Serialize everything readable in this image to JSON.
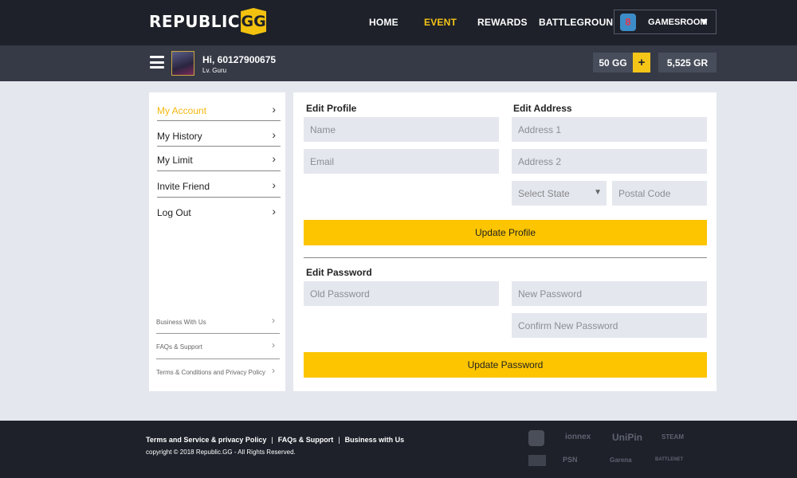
{
  "brand": {
    "logo_text": "REPUBLIC",
    "logo_mark": "GG"
  },
  "nav": {
    "items": [
      {
        "label": "HOME",
        "active": false
      },
      {
        "label": "EVENT",
        "active": true
      },
      {
        "label": "REWARDS",
        "active": false
      },
      {
        "label": "BATTLEGROUND",
        "active": false
      }
    ],
    "games_dropdown": "GAMESROOM"
  },
  "user": {
    "greeting": "Hi, 60127900675",
    "level": "Lv. Guru",
    "gg_balance": "50 GG",
    "gr_balance": "5,525 GR",
    "add_label": "+"
  },
  "sidebar": {
    "items": [
      {
        "label": "My Account",
        "active": true
      },
      {
        "label": "My History",
        "active": false
      },
      {
        "label": "My Limit",
        "active": false
      },
      {
        "label": "Invite Friend",
        "active": false
      },
      {
        "label": "Log Out",
        "active": false
      }
    ],
    "secondary": [
      {
        "label": "Business With Us"
      },
      {
        "label": "FAQs & Support"
      },
      {
        "label": "Terms & Conditions and Privacy Policy"
      }
    ]
  },
  "profile": {
    "title": "Edit Profile",
    "name_placeholder": "Name",
    "email_placeholder": "Email",
    "button": "Update Profile"
  },
  "address": {
    "title": "Edit Address",
    "address1_placeholder": "Address 1",
    "address2_placeholder": "Address 2",
    "state_placeholder": "Select State",
    "postal_placeholder": "Postal Code"
  },
  "password": {
    "title": "Edit Password",
    "old_placeholder": "Old Password",
    "new_placeholder": "New Password",
    "confirm_placeholder": "Confirm New Password",
    "button": "Update Password"
  },
  "footer": {
    "links": [
      "Terms and Service & privacy Policy",
      "FAQs & Support",
      "Business with Us"
    ],
    "copyright": "copyright © 2018 Republic.GG  -  All Rights Reserved.",
    "partners": [
      "ionnex",
      "UniPin",
      "STEAM",
      "PSN",
      "Garena",
      "BATTLENET"
    ]
  },
  "colors": {
    "accent": "#fcc500",
    "topbar": "#1e212a",
    "userbar": "#363a46",
    "background": "#e4e7ee"
  }
}
